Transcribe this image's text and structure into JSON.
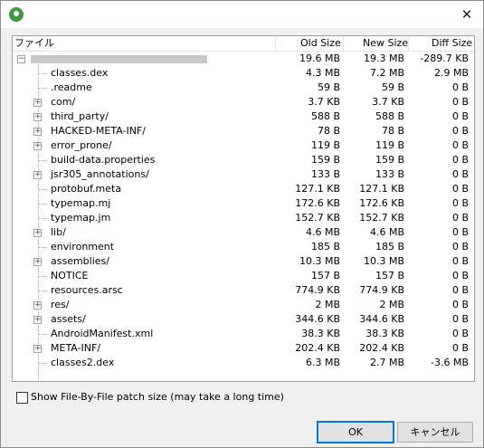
{
  "window": {
    "close_icon": "close-icon"
  },
  "columns": {
    "name": "ファイル",
    "old": "Old Size",
    "new": "New Size",
    "diff": "Diff Size"
  },
  "root": {
    "old": "19.6 MB",
    "new": "19.3 MB",
    "diff": "-289.7 KB"
  },
  "rows": [
    {
      "name": "classes.dex",
      "old": "4.3 MB",
      "new": "7.2 MB",
      "diff": "2.9 MB",
      "expandable": false
    },
    {
      "name": ".readme",
      "old": "59 B",
      "new": "59 B",
      "diff": "0 B",
      "expandable": false
    },
    {
      "name": "com/",
      "old": "3.7 KB",
      "new": "3.7 KB",
      "diff": "0 B",
      "expandable": true
    },
    {
      "name": "third_party/",
      "old": "588 B",
      "new": "588 B",
      "diff": "0 B",
      "expandable": true
    },
    {
      "name": "HACKED-META-INF/",
      "old": "78 B",
      "new": "78 B",
      "diff": "0 B",
      "expandable": true
    },
    {
      "name": "error_prone/",
      "old": "119 B",
      "new": "119 B",
      "diff": "0 B",
      "expandable": true
    },
    {
      "name": "build-data.properties",
      "old": "159 B",
      "new": "159 B",
      "diff": "0 B",
      "expandable": false
    },
    {
      "name": "jsr305_annotations/",
      "old": "133 B",
      "new": "133 B",
      "diff": "0 B",
      "expandable": true
    },
    {
      "name": "protobuf.meta",
      "old": "127.1 KB",
      "new": "127.1 KB",
      "diff": "0 B",
      "expandable": false
    },
    {
      "name": "typemap.mj",
      "old": "172.6 KB",
      "new": "172.6 KB",
      "diff": "0 B",
      "expandable": false
    },
    {
      "name": "typemap.jm",
      "old": "152.7 KB",
      "new": "152.7 KB",
      "diff": "0 B",
      "expandable": false
    },
    {
      "name": "lib/",
      "old": "4.6 MB",
      "new": "4.6 MB",
      "diff": "0 B",
      "expandable": true
    },
    {
      "name": "environment",
      "old": "185 B",
      "new": "185 B",
      "diff": "0 B",
      "expandable": false
    },
    {
      "name": "assemblies/",
      "old": "10.3 MB",
      "new": "10.3 MB",
      "diff": "0 B",
      "expandable": true
    },
    {
      "name": "NOTICE",
      "old": "157 B",
      "new": "157 B",
      "diff": "0 B",
      "expandable": false
    },
    {
      "name": "resources.arsc",
      "old": "774.9 KB",
      "new": "774.9 KB",
      "diff": "0 B",
      "expandable": false
    },
    {
      "name": "res/",
      "old": "2 MB",
      "new": "2 MB",
      "diff": "0 B",
      "expandable": true
    },
    {
      "name": "assets/",
      "old": "344.6 KB",
      "new": "344.6 KB",
      "diff": "0 B",
      "expandable": true
    },
    {
      "name": "AndroidManifest.xml",
      "old": "38.3 KB",
      "new": "38.3 KB",
      "diff": "0 B",
      "expandable": false
    },
    {
      "name": "META-INF/",
      "old": "202.4 KB",
      "new": "202.4 KB",
      "diff": "0 B",
      "expandable": true
    },
    {
      "name": "classes2.dex",
      "old": "6.3 MB",
      "new": "2.7 MB",
      "diff": "-3.6 MB",
      "expandable": false
    }
  ],
  "checkbox": {
    "label": "Show File-By-File patch size (may take a long time)",
    "checked": false
  },
  "buttons": {
    "ok": "OK",
    "cancel": "キャンセル"
  }
}
